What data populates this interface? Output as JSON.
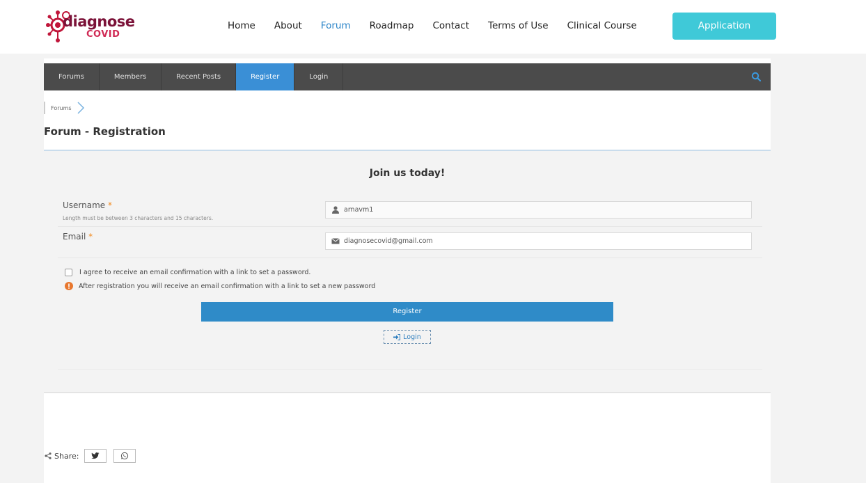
{
  "header": {
    "logo": {
      "word": "diagnose",
      "sub": "COVID"
    },
    "nav": [
      {
        "label": "Home"
      },
      {
        "label": "About"
      },
      {
        "label": "Forum",
        "active": true
      },
      {
        "label": "Roadmap"
      },
      {
        "label": "Contact"
      },
      {
        "label": "Terms of Use"
      },
      {
        "label": "Clinical Course"
      }
    ],
    "cta": "Application"
  },
  "forum_bar": {
    "items": [
      {
        "label": "Forums"
      },
      {
        "label": "Members"
      },
      {
        "label": "Recent Posts"
      },
      {
        "label": "Register",
        "active": true
      },
      {
        "label": "Login"
      }
    ],
    "search_icon": "search-icon"
  },
  "breadcrumb": {
    "item": "Forums"
  },
  "page": {
    "title": "Forum - Registration"
  },
  "form": {
    "heading": "Join us today!",
    "username": {
      "label": "Username",
      "required_mark": "*",
      "hint": "Length must be between 3 characters and 15 characters.",
      "value": "arnavm1",
      "icon": "user-icon"
    },
    "email": {
      "label": "Email",
      "required_mark": "*",
      "value": "diagnosecovid@gmail.com",
      "icon": "envelope-icon"
    },
    "agree_checkbox": {
      "label": "I agree to receive an email confirmation with a link to set a password.",
      "checked": false
    },
    "notice": {
      "text": "After registration you will receive an email confirmation with a link to set a new password",
      "icon": "warning-icon"
    },
    "register_button": "Register",
    "login_button": "Login"
  },
  "share": {
    "label": "Share:",
    "buttons": [
      {
        "icon": "twitter-icon"
      },
      {
        "icon": "whatsapp-icon"
      }
    ]
  },
  "colors": {
    "active_link": "#2a84c8",
    "cta": "#3fc9d8",
    "forum_bar": "#4b4b4b",
    "register_button": "#2f8bc8",
    "required": "#f28a1e",
    "logo": "#7b1238"
  }
}
